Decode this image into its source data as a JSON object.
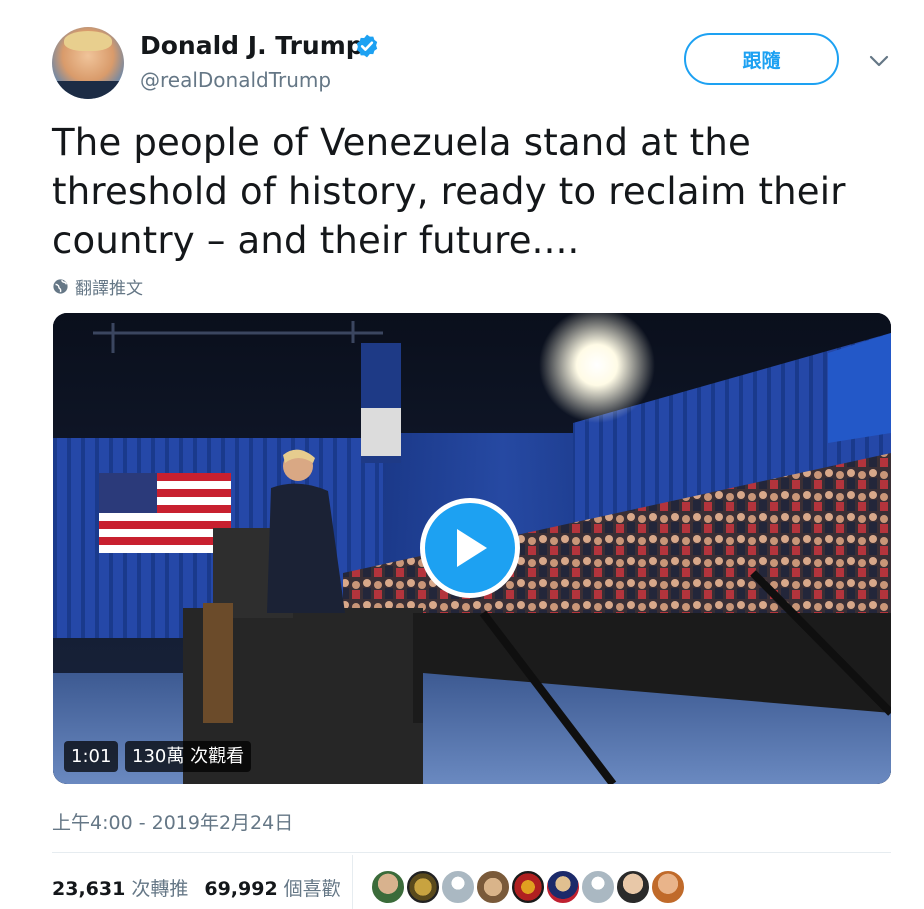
{
  "author": {
    "display_name": "Donald J. Trump",
    "handle": "@realDonaldTrump",
    "verified": true
  },
  "follow_button_label": "跟隨",
  "tweet_text": "The people of Venezuela stand at the threshold of history, ready to reclaim their country – and their future....",
  "translate_label": "翻譯推文",
  "video": {
    "duration": "1:01",
    "views": "130萬 次觀看"
  },
  "timestamp": "上午4:00 - 2019年2月24日",
  "stats": {
    "retweets_count": "23,631",
    "retweets_label": "次轉推",
    "likes_count": "69,992",
    "likes_label": "個喜歡"
  },
  "liker_avatars": [
    "liker-avatar-1",
    "liker-avatar-2",
    "liker-avatar-3",
    "liker-avatar-4",
    "liker-avatar-5",
    "liker-avatar-6",
    "liker-avatar-7",
    "liker-avatar-8",
    "liker-avatar-9"
  ],
  "colors": {
    "accent": "#1da1f2",
    "text_primary": "#14171a",
    "text_secondary": "#657786",
    "divider": "#e6ecf0"
  }
}
